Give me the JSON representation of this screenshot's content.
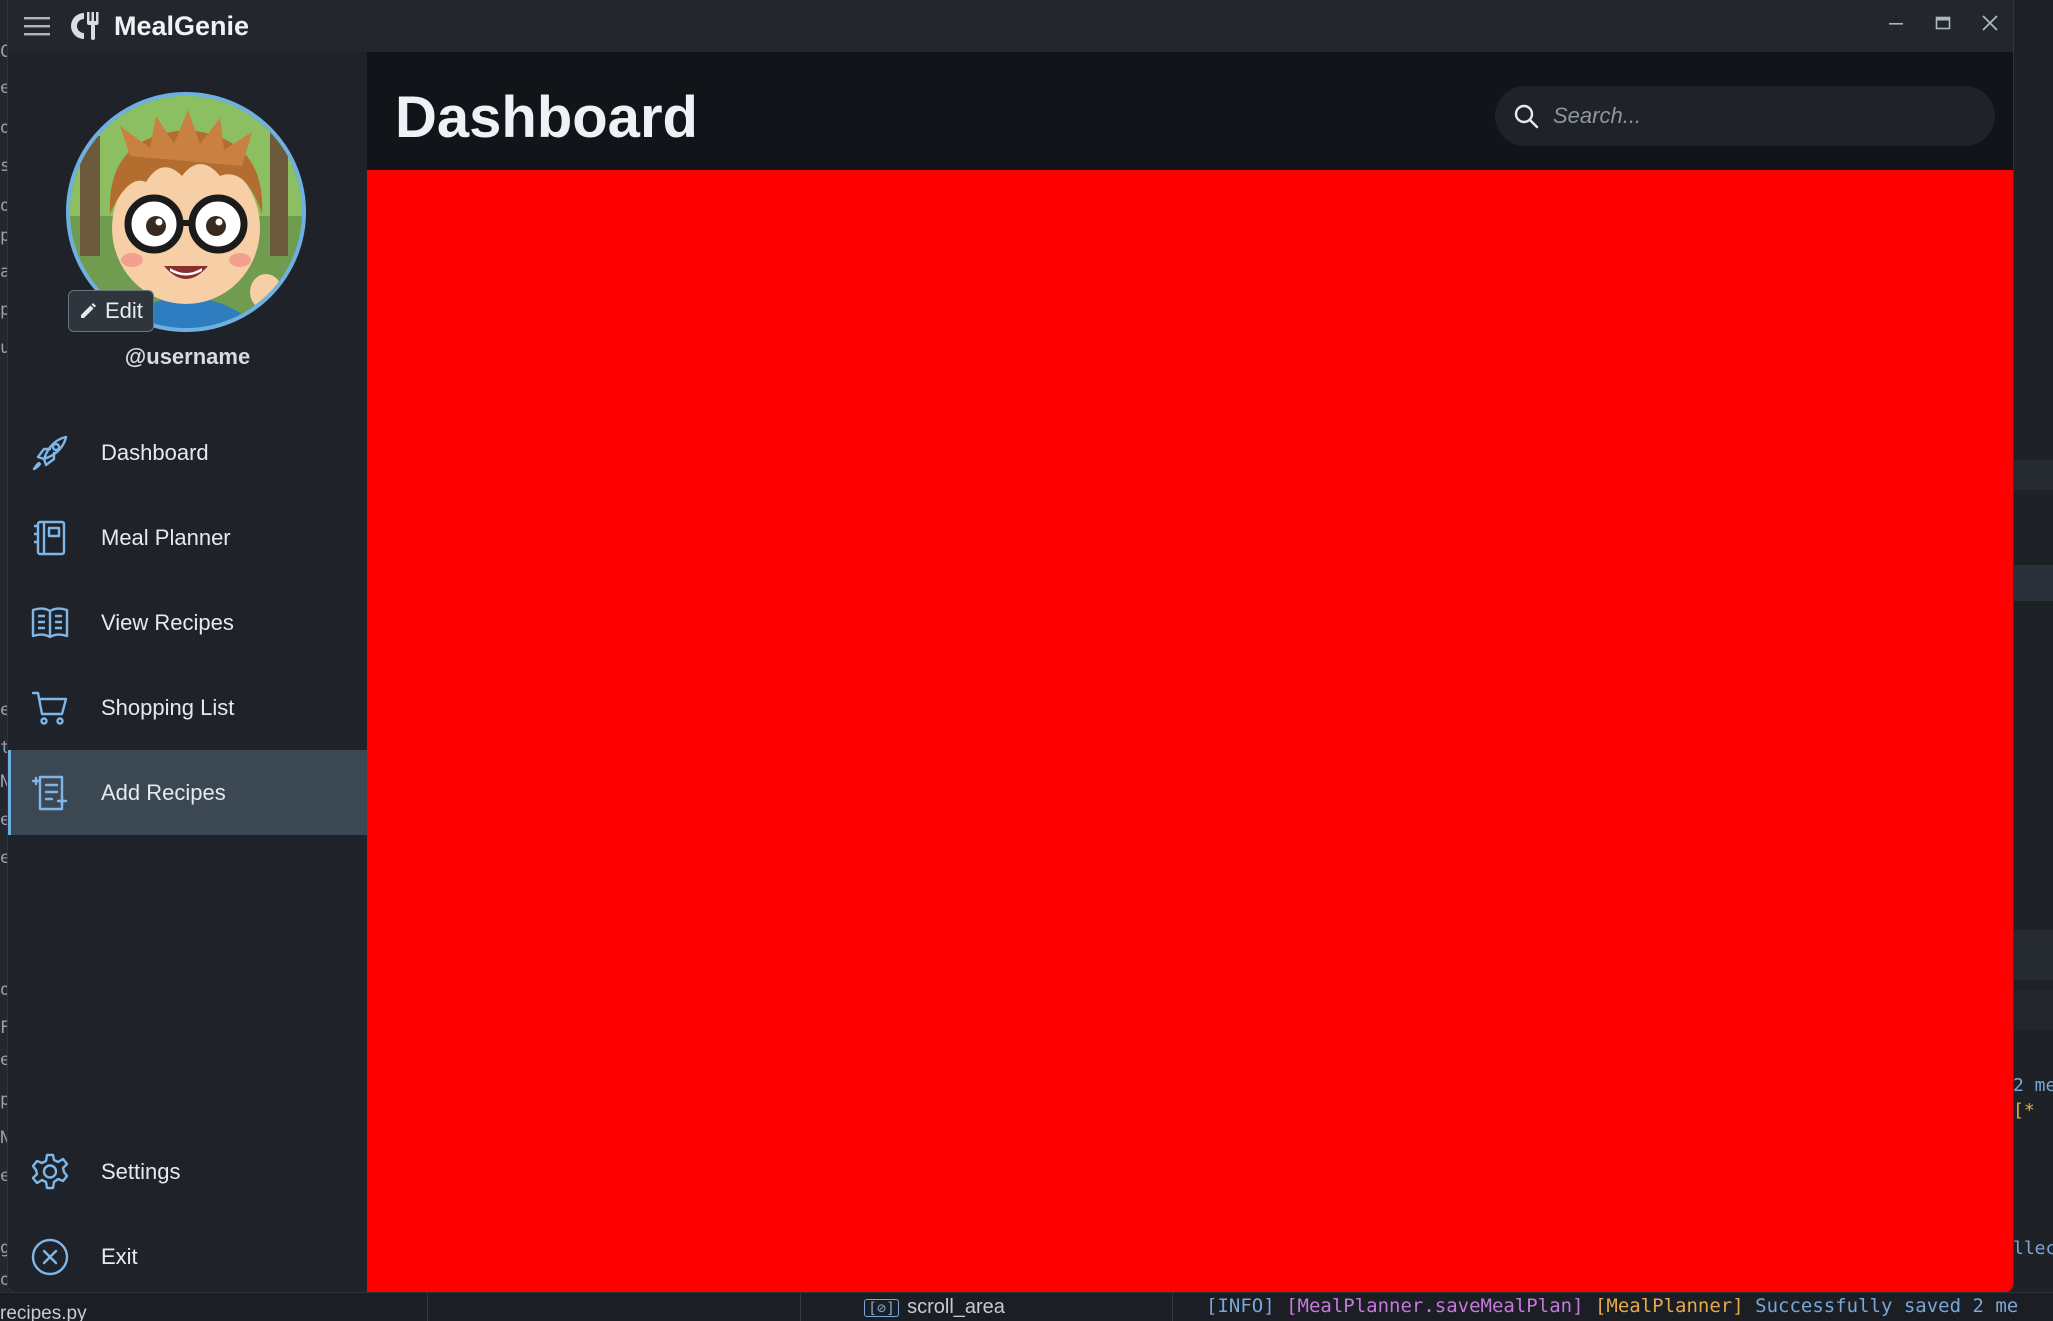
{
  "window": {
    "app_title": "MealGenie"
  },
  "profile": {
    "edit_label": "Edit",
    "username": "@username"
  },
  "sidebar": {
    "items": [
      {
        "label": "Dashboard",
        "icon": "rocket-icon",
        "active": false
      },
      {
        "label": "Meal Planner",
        "icon": "planner-book-icon",
        "active": false
      },
      {
        "label": "View Recipes",
        "icon": "open-book-icon",
        "active": false
      },
      {
        "label": "Shopping List",
        "icon": "shopping-cart-icon",
        "active": false
      },
      {
        "label": "Add Recipes",
        "icon": "add-recipe-icon",
        "active": true
      }
    ],
    "bottom_items": [
      {
        "label": "Settings",
        "icon": "gear-icon"
      },
      {
        "label": "Exit",
        "icon": "exit-circle-icon"
      }
    ]
  },
  "header": {
    "page_title": "Dashboard",
    "search_placeholder": "Search..."
  },
  "colors": {
    "accent": "#6fb0e3",
    "content_background": "#ff0000",
    "active_nav": "#3b4752"
  },
  "background_editor": {
    "left_gutter_chars": [
      "C",
      "e",
      "o",
      "s",
      "o",
      "p",
      "a",
      "p",
      "u",
      "e",
      "t",
      "N",
      "e",
      "e",
      "o",
      "F",
      "e",
      "p",
      "N",
      "e",
      "g",
      "o"
    ],
    "right_fragments": [
      "2 me",
      "[*",
      "llec"
    ],
    "status_file": "recipes.py",
    "status_scroll": "scroll_area",
    "status_log": {
      "level": "[INFO]",
      "source": "[MealPlanner.saveMealPlan]",
      "tag": "[MealPlanner]",
      "message": "Successfully saved 2 me"
    }
  }
}
